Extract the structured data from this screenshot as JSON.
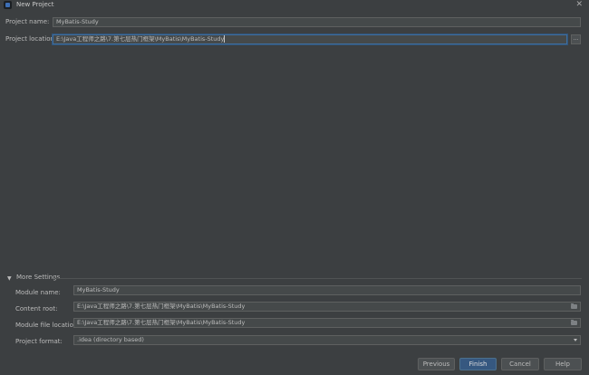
{
  "window": {
    "title": "New Project",
    "close_glyph": "✕"
  },
  "project": {
    "name_label": "Project name:",
    "name_value": "MyBatis-Study",
    "location_label": "Project location:",
    "location_value": "E:\\Java工程师之路\\7.第七层热门框架\\MyBatis\\MyBatis-Study",
    "browse_label": "..."
  },
  "more_settings": {
    "title": "More Settings",
    "module_name_label": "Module name:",
    "module_name_value": "MyBatis-Study",
    "content_root_label": "Content root:",
    "content_root_value": "E:\\Java工程师之路\\7.第七层热门框架\\MyBatis\\MyBatis-Study",
    "module_file_label": "Module file location:",
    "module_file_value": "E:\\Java工程师之路\\7.第七层热门框架\\MyBatis\\MyBatis-Study",
    "format_label": "Project format:",
    "format_value": ".idea (directory based)"
  },
  "buttons": {
    "previous": "Previous",
    "finish": "Finish",
    "cancel": "Cancel",
    "help": "Help"
  },
  "icons": {
    "app": "intellij-app-icon",
    "close": "close-icon",
    "folder": "folder-icon",
    "dropdown": "chevron-down-icon",
    "collapse": "triangle-down-icon"
  },
  "colors": {
    "background": "#3c3f41",
    "field_bg": "#45494a",
    "focus_border": "#3f6d9d",
    "primary_button": "#365880"
  }
}
